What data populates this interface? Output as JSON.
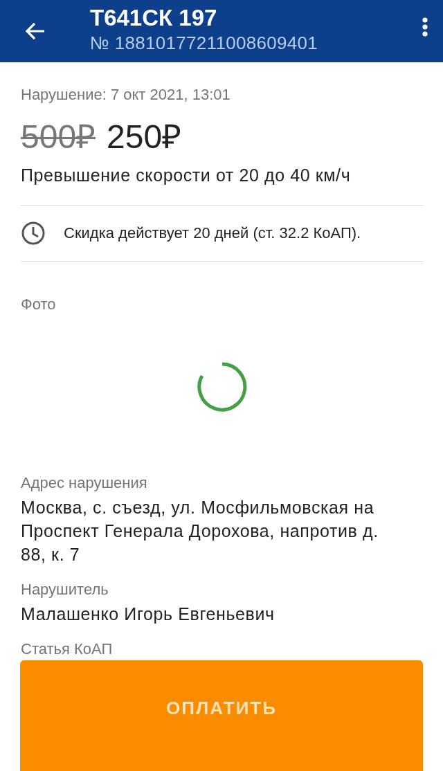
{
  "header": {
    "title": "Т641СК 197",
    "subtitle": "№ 18810177211008609401"
  },
  "violation_date": "Нарушение: 7 окт 2021, 13:01",
  "old_price": "500₽",
  "price": "250₽",
  "description": "Превышение скорости от 20 до 40 км/ч",
  "discount_note": "Скидка действует 20 дней (ст. 32.2 КоАП).",
  "photo": {
    "label": "Фото",
    "loading": true
  },
  "fields": [
    {
      "label": "Адрес нарушения",
      "value": "Москва, с. съезд, ул. Мосфильмовская на Проспект Генерала Дорохова, напротив д. 88, к. 7"
    },
    {
      "label": "Нарушитель",
      "value": "Малашенко Игорь Евгеньевич"
    },
    {
      "label": "Статья КоАП"
    }
  ],
  "pay_button": "ОПЛАТИТЬ"
}
